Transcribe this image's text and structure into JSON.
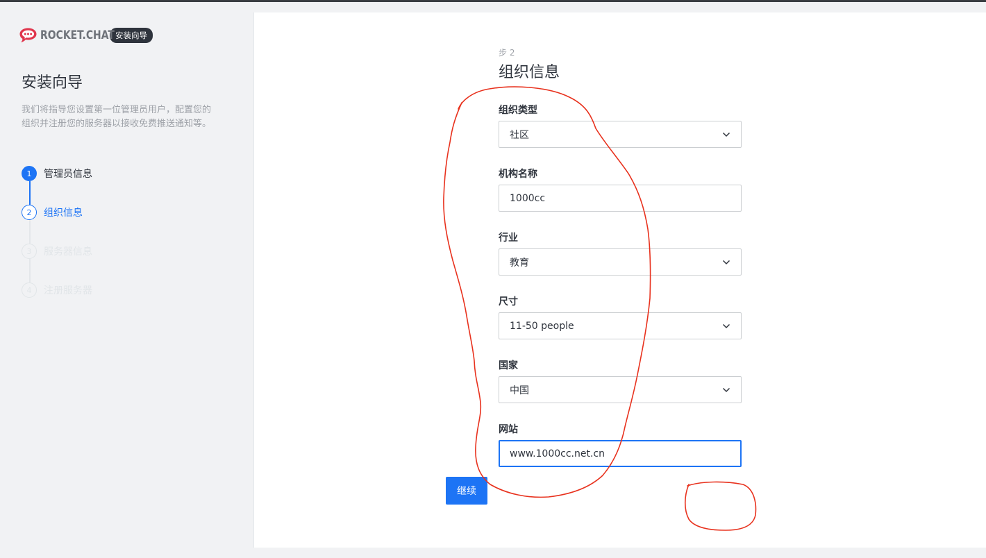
{
  "sidebar": {
    "logo_text": "ROCKET.CHAT",
    "logo_tag": "安装向导",
    "title": "安装向导",
    "description": "我们将指导您设置第一位管理员用户，配置您的组织并注册您的服务器以接收免费推送通知等。",
    "steps": [
      {
        "number": "1",
        "label": "管理员信息",
        "state": "done"
      },
      {
        "number": "2",
        "label": "组织信息",
        "state": "active"
      },
      {
        "number": "3",
        "label": "服务器信息",
        "state": "todo"
      },
      {
        "number": "4",
        "label": "注册服务器",
        "state": "todo"
      }
    ]
  },
  "form": {
    "step_label": "步 2",
    "title": "组织信息",
    "fields": [
      {
        "label": "组织类型",
        "value": "社区",
        "type": "select"
      },
      {
        "label": "机构名称",
        "value": "1000cc",
        "type": "text"
      },
      {
        "label": "行业",
        "value": "教育",
        "type": "select"
      },
      {
        "label": "尺寸",
        "value": "11-50 people",
        "type": "select"
      },
      {
        "label": "国家",
        "value": "中国",
        "type": "select"
      },
      {
        "label": "网站",
        "value": "www.1000cc.net.cn",
        "type": "text"
      }
    ],
    "continue_label": "继续"
  },
  "icons": {
    "logo": "rocket-chat-logo-icon",
    "select_arrow": "chevron-down-icon"
  },
  "colors": {
    "accent": "#1d74f5",
    "annotation": "#e8321e",
    "logo": "#e0364d"
  }
}
